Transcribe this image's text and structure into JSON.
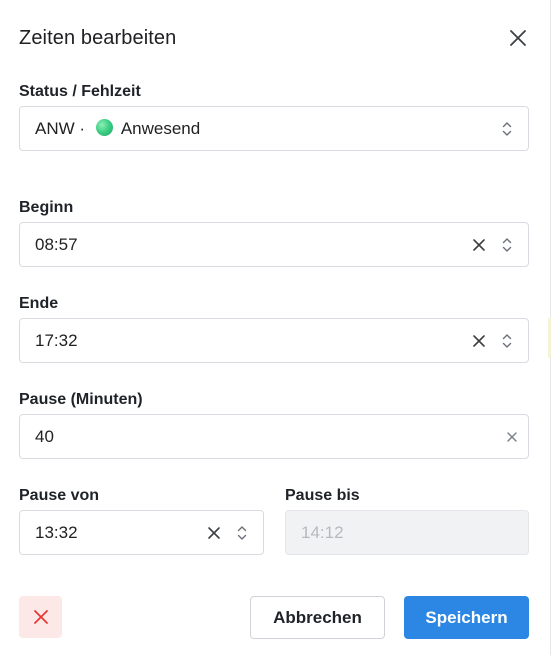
{
  "dialog": {
    "title": "Zeiten bearbeiten"
  },
  "status": {
    "label": "Status / Fehlzeit",
    "code": "ANW",
    "separator": "·",
    "text": "Anwesend",
    "dot_color": "#3fcf86"
  },
  "start": {
    "label": "Beginn",
    "value": "08:57"
  },
  "end": {
    "label": "Ende",
    "value": "17:32"
  },
  "pause_minutes": {
    "label": "Pause (Minuten)",
    "value": "40"
  },
  "pause_from": {
    "label": "Pause von",
    "value": "13:32"
  },
  "pause_to": {
    "label": "Pause bis",
    "value": "14:12"
  },
  "actions": {
    "cancel_label": "Abbrechen",
    "save_label": "Speichern"
  },
  "colors": {
    "primary": "#2b87e3",
    "danger": "#e53935",
    "danger_bg": "#fde8e8"
  },
  "icons": {
    "close": "close-icon",
    "clear": "clear-icon",
    "select": "chevron-up-down-icon",
    "delete": "delete-x-icon"
  }
}
